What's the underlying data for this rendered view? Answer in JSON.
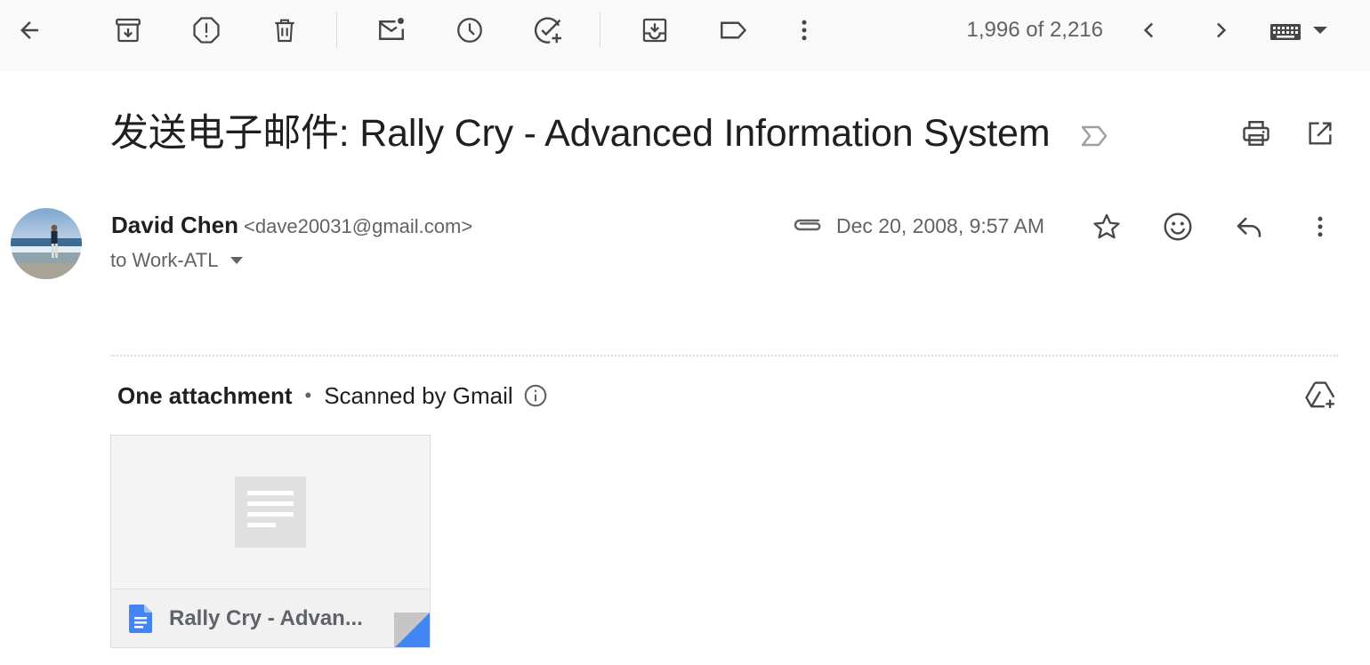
{
  "toolbar": {
    "buttons": [
      {
        "name": "back",
        "icon": "arrow-left-icon",
        "label": "Back to Inbox"
      },
      {
        "name": "archive",
        "icon": "archive-icon",
        "label": "Archive"
      },
      {
        "name": "report-spam",
        "icon": "report-spam-icon",
        "label": "Report spam"
      },
      {
        "name": "delete",
        "icon": "trash-icon",
        "label": "Delete"
      },
      {
        "name": "mark-unread",
        "icon": "mark-unread-icon",
        "label": "Mark as unread"
      },
      {
        "name": "snooze",
        "icon": "clock-icon",
        "label": "Snooze"
      },
      {
        "name": "add-to-tasks",
        "icon": "add-task-icon",
        "label": "Add to Tasks"
      },
      {
        "name": "move-to",
        "icon": "move-to-inbox-icon",
        "label": "Move to"
      },
      {
        "name": "labels",
        "icon": "label-icon",
        "label": "Labels"
      },
      {
        "name": "more",
        "icon": "more-vert-icon",
        "label": "More"
      }
    ],
    "counter": "1,996 of 2,216",
    "prev_icon": "chevron-left-icon",
    "next_icon": "chevron-right-icon",
    "input_tools_icon": "keyboard-icon"
  },
  "email": {
    "subject": "发送电子邮件: Rally Cry - Advanced Information System",
    "importance_icon": "importance-marker-icon",
    "sender_name": "David Chen",
    "sender_email": "<dave20031@gmail.com>",
    "recipients": "to Work-ATL",
    "date": "Dec 20, 2008, 9:57 AM",
    "has_attachment": true
  },
  "attachments": {
    "count_label": "One attachment",
    "separator": "•",
    "scanned_label": "Scanned by Gmail",
    "items": [
      {
        "filename": "Rally Cry - Advan...",
        "file_icon": "google-docs-icon",
        "accent": "#4285f4"
      }
    ]
  },
  "colors": {
    "toolbar_bg": "#f9f9f9",
    "icon": "#444746",
    "muted_text": "#5f6368",
    "docs_blue": "#4285f4"
  }
}
